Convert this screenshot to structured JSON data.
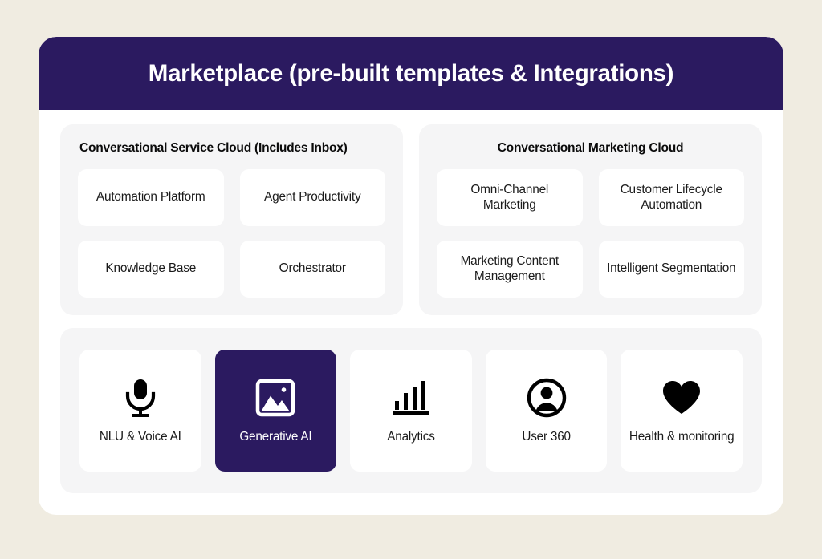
{
  "header": {
    "title": "Marketplace (pre-built templates & Integrations)",
    "background_color": "#2b1a60",
    "text_color": "#ffffff"
  },
  "theme": {
    "page_background": "#f0ece1",
    "card_background": "#ffffff",
    "panel_background": "#f5f5f6",
    "accent_purple": "#2b1a60",
    "text_color": "#1b1b1b"
  },
  "clouds": [
    {
      "heading": "Conversational Service Cloud (Includes Inbox)",
      "tiles": [
        {
          "label": "Automation Platform"
        },
        {
          "label": "Agent Productivity"
        },
        {
          "label": "Knowledge Base"
        },
        {
          "label": "Orchestrator"
        }
      ]
    },
    {
      "heading": "Conversational Marketing Cloud",
      "tiles": [
        {
          "label": "Omni-Channel Marketing"
        },
        {
          "label": "Customer Lifecycle Automation"
        },
        {
          "label": "Marketing Content Management"
        },
        {
          "label": "Intelligent Segmentation"
        }
      ]
    }
  ],
  "capabilities": [
    {
      "label": "NLU & Voice AI",
      "icon": "microphone-icon",
      "active": false
    },
    {
      "label": "Generative AI",
      "icon": "image-icon",
      "active": true
    },
    {
      "label": "Analytics",
      "icon": "bar-chart-icon",
      "active": false
    },
    {
      "label": "User 360",
      "icon": "account-circle-icon",
      "active": false
    },
    {
      "label": "Health & monitoring",
      "icon": "heart-icon",
      "active": false
    }
  ]
}
